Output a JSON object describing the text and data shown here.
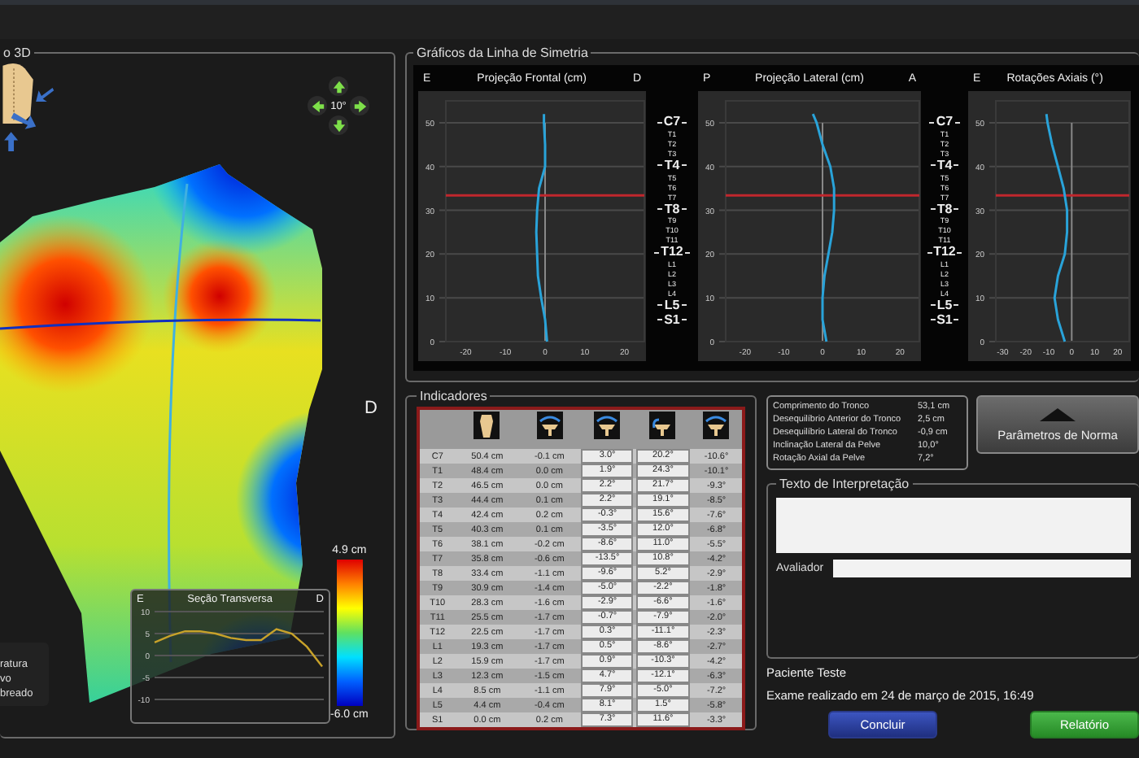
{
  "model_3d": {
    "title": "o 3D",
    "rotation_step": "10°",
    "side_label": "D",
    "scale": {
      "max": "4.9 cm",
      "min": "-6.0 cm"
    },
    "legend_items": [
      "ratura",
      "vo",
      "breado"
    ],
    "transverse": {
      "left_label": "E",
      "right_label": "D",
      "chart_data": {
        "type": "line",
        "title": "Seção Transversa",
        "grid": true,
        "series": [
          {
            "color": "#c8a22a",
            "values": [
              3,
              4.5,
              5.5,
              5.5,
              5,
              4,
              3.5,
              3.5,
              6,
              5,
              2,
              -2.5
            ]
          }
        ],
        "ylim": [
          -10,
          10
        ],
        "yticks": [
          10,
          5,
          0,
          -5,
          -10
        ]
      }
    }
  },
  "symmetry": {
    "title": "Gráficos da Linha de Simetria",
    "charts": [
      {
        "left_label": "E",
        "right_label": "D",
        "chart_data": {
          "type": "line",
          "title": "Projeção Frontal (cm)",
          "grid": true,
          "x": [
            0.5,
            0,
            -1,
            -1.8,
            -2,
            -2.2,
            -2,
            -1.5,
            0,
            0,
            -0.3,
            -0.3
          ],
          "series": [
            {
              "color": "#29a3d9",
              "values": [
                0,
                5,
                10,
                15,
                20,
                25,
                30,
                35,
                40,
                45,
                50,
                52
              ]
            }
          ],
          "xlim": [
            -25,
            25
          ],
          "xticks": [
            -20,
            -10,
            0,
            10,
            20
          ],
          "ylim": [
            0,
            55
          ],
          "yticks": [
            0,
            10,
            20,
            30,
            40,
            50
          ],
          "ref_lines": [
            {
              "axis": "y",
              "value": 33.4
            }
          ]
        }
      },
      {
        "left_label": "P",
        "right_label": "A",
        "chart_data": {
          "type": "line",
          "title": "Projeção Lateral (cm)",
          "grid": true,
          "x": [
            1,
            0,
            0,
            0.5,
            1.5,
            2.5,
            3,
            3,
            2,
            0,
            -1.5,
            -2.5
          ],
          "series": [
            {
              "color": "#29a3d9",
              "values": [
                0,
                5,
                10,
                15,
                20,
                25,
                30,
                35,
                40,
                45,
                50,
                52
              ]
            }
          ],
          "xlim": [
            -25,
            25
          ],
          "xticks": [
            -20,
            -10,
            0,
            10,
            20
          ],
          "ylim": [
            0,
            55
          ],
          "yticks": [
            0,
            10,
            20,
            30,
            40,
            50
          ],
          "ref_lines": [
            {
              "axis": "y",
              "value": 33.4
            }
          ]
        }
      },
      {
        "left_label": "E",
        "chart_data": {
          "type": "line",
          "title": "Rotações Axiais (°)",
          "grid": true,
          "x": [
            -3,
            -6,
            -7.5,
            -6,
            -3,
            -2,
            -2,
            -3.5,
            -6,
            -8.5,
            -10.5,
            -11
          ],
          "series": [
            {
              "color": "#29a3d9",
              "values": [
                0,
                5,
                10,
                15,
                20,
                25,
                30,
                35,
                40,
                45,
                50,
                52
              ]
            }
          ],
          "xlim": [
            -33,
            25
          ],
          "xticks": [
            -30,
            -20,
            -10,
            0,
            10,
            20
          ],
          "ylim": [
            0,
            55
          ],
          "yticks": [
            0,
            10,
            20,
            30,
            40,
            50
          ],
          "ref_lines": [
            {
              "axis": "y",
              "value": 33.4
            }
          ]
        }
      }
    ],
    "vertebra_columns": [
      [
        {
          "text": "C7",
          "major": true
        },
        {
          "text": "T1",
          "major": false
        },
        {
          "text": "T2",
          "major": false
        },
        {
          "text": "T3",
          "major": false
        },
        {
          "text": "T4",
          "major": true
        },
        {
          "text": "T5",
          "major": false
        },
        {
          "text": "T6",
          "major": false
        },
        {
          "text": "T7",
          "major": false
        },
        {
          "text": "T8",
          "major": true
        },
        {
          "text": "T9",
          "major": false
        },
        {
          "text": "T10",
          "major": false
        },
        {
          "text": "T11",
          "major": false
        },
        {
          "text": "T12",
          "major": true
        },
        {
          "text": "L1",
          "major": false
        },
        {
          "text": "L2",
          "major": false
        },
        {
          "text": "L3",
          "major": false
        },
        {
          "text": "L4",
          "major": false
        },
        {
          "text": "L5",
          "major": true
        },
        {
          "text": "S1",
          "major": true
        }
      ],
      [
        {
          "text": "C7",
          "major": true
        },
        {
          "text": "T1",
          "major": false
        },
        {
          "text": "T2",
          "major": false
        },
        {
          "text": "T3",
          "major": false
        },
        {
          "text": "T4",
          "major": true
        },
        {
          "text": "T5",
          "major": false
        },
        {
          "text": "T6",
          "major": false
        },
        {
          "text": "T7",
          "major": false
        },
        {
          "text": "T8",
          "major": true
        },
        {
          "text": "T9",
          "major": false
        },
        {
          "text": "T10",
          "major": false
        },
        {
          "text": "T11",
          "major": false
        },
        {
          "text": "T12",
          "major": true
        },
        {
          "text": "L1",
          "major": false
        },
        {
          "text": "L2",
          "major": false
        },
        {
          "text": "L3",
          "major": false
        },
        {
          "text": "L4",
          "major": false
        },
        {
          "text": "L5",
          "major": true
        },
        {
          "text": "S1",
          "major": true
        }
      ]
    ]
  },
  "indicators": {
    "title": "Indicadores",
    "rows": [
      {
        "cells": [
          "C7",
          "50.4 cm",
          "-0.1 cm",
          "3.0°",
          "20.2°",
          "-10.6°"
        ]
      },
      {
        "cells": [
          "T1",
          "48.4 cm",
          "0.0 cm",
          "1.9°",
          "24.3°",
          "-10.1°"
        ]
      },
      {
        "cells": [
          "T2",
          "46.5 cm",
          "0.0 cm",
          "2.2°",
          "21.7°",
          "-9.3°"
        ]
      },
      {
        "cells": [
          "T3",
          "44.4 cm",
          "0.1 cm",
          "2.2°",
          "19.1°",
          "-8.5°"
        ]
      },
      {
        "cells": [
          "T4",
          "42.4 cm",
          "0.2 cm",
          "-0.3°",
          "15.6°",
          "-7.6°"
        ]
      },
      {
        "cells": [
          "T5",
          "40.3 cm",
          "0.1 cm",
          "-3.5°",
          "12.0°",
          "-6.8°"
        ]
      },
      {
        "cells": [
          "T6",
          "38.1 cm",
          "-0.2 cm",
          "-8.6°",
          "11.0°",
          "-5.5°"
        ]
      },
      {
        "cells": [
          "T7",
          "35.8 cm",
          "-0.6 cm",
          "-13.5°",
          "10.8°",
          "-4.2°"
        ]
      },
      {
        "cells": [
          "T8",
          "33.4 cm",
          "-1.1 cm",
          "-9.6°",
          "5.2°",
          "-2.9°"
        ]
      },
      {
        "cells": [
          "T9",
          "30.9 cm",
          "-1.4 cm",
          "-5.0°",
          "-2.2°",
          "-1.8°"
        ]
      },
      {
        "cells": [
          "T10",
          "28.3 cm",
          "-1.6 cm",
          "-2.9°",
          "-6.6°",
          "-1.6°"
        ]
      },
      {
        "cells": [
          "T11",
          "25.5 cm",
          "-1.7 cm",
          "-0.7°",
          "-7.9°",
          "-2.0°"
        ]
      },
      {
        "cells": [
          "T12",
          "22.5 cm",
          "-1.7 cm",
          "0.3°",
          "-11.1°",
          "-2.3°"
        ]
      },
      {
        "cells": [
          "L1",
          "19.3 cm",
          "-1.7 cm",
          "0.5°",
          "-8.6°",
          "-2.7°"
        ]
      },
      {
        "cells": [
          "L2",
          "15.9 cm",
          "-1.7 cm",
          "0.9°",
          "-10.3°",
          "-4.2°"
        ]
      },
      {
        "cells": [
          "L3",
          "12.3 cm",
          "-1.5 cm",
          "4.7°",
          "-12.1°",
          "-6.3°"
        ]
      },
      {
        "cells": [
          "L4",
          "8.5 cm",
          "-1.1 cm",
          "7.9°",
          "-5.0°",
          "-7.2°"
        ]
      },
      {
        "cells": [
          "L5",
          "4.4 cm",
          "-0.4 cm",
          "8.1°",
          "1.5°",
          "-5.8°"
        ]
      },
      {
        "cells": [
          "S1",
          "0.0 cm",
          "0.2 cm",
          "7.3°",
          "11.6°",
          "-3.3°"
        ]
      }
    ]
  },
  "summary": [
    {
      "label": "Comprimento do Tronco",
      "value": "53,1 cm"
    },
    {
      "label": "Desequilíbrio Anterior do Tronco",
      "value": "2,5 cm"
    },
    {
      "label": "Desequilíbrio Lateral do Tronco",
      "value": "-0,9 cm"
    },
    {
      "label": "Inclinação Lateral da Pelve",
      "value": "10,0°"
    },
    {
      "label": "Rotação Axial da Pelve",
      "value": "7,2°"
    }
  ],
  "norm_button": "Parâmetros de Norma",
  "interpretation": {
    "title": "Texto de Interpretação",
    "evaluator_label": "Avaliador"
  },
  "patient": "Paciente Teste",
  "exam": "Exame realizado em 24 de março de 2015, 16:49",
  "buttons": [
    {
      "label": "Concluir",
      "kind": "primary"
    },
    {
      "label": "Relatório",
      "kind": "success"
    }
  ]
}
